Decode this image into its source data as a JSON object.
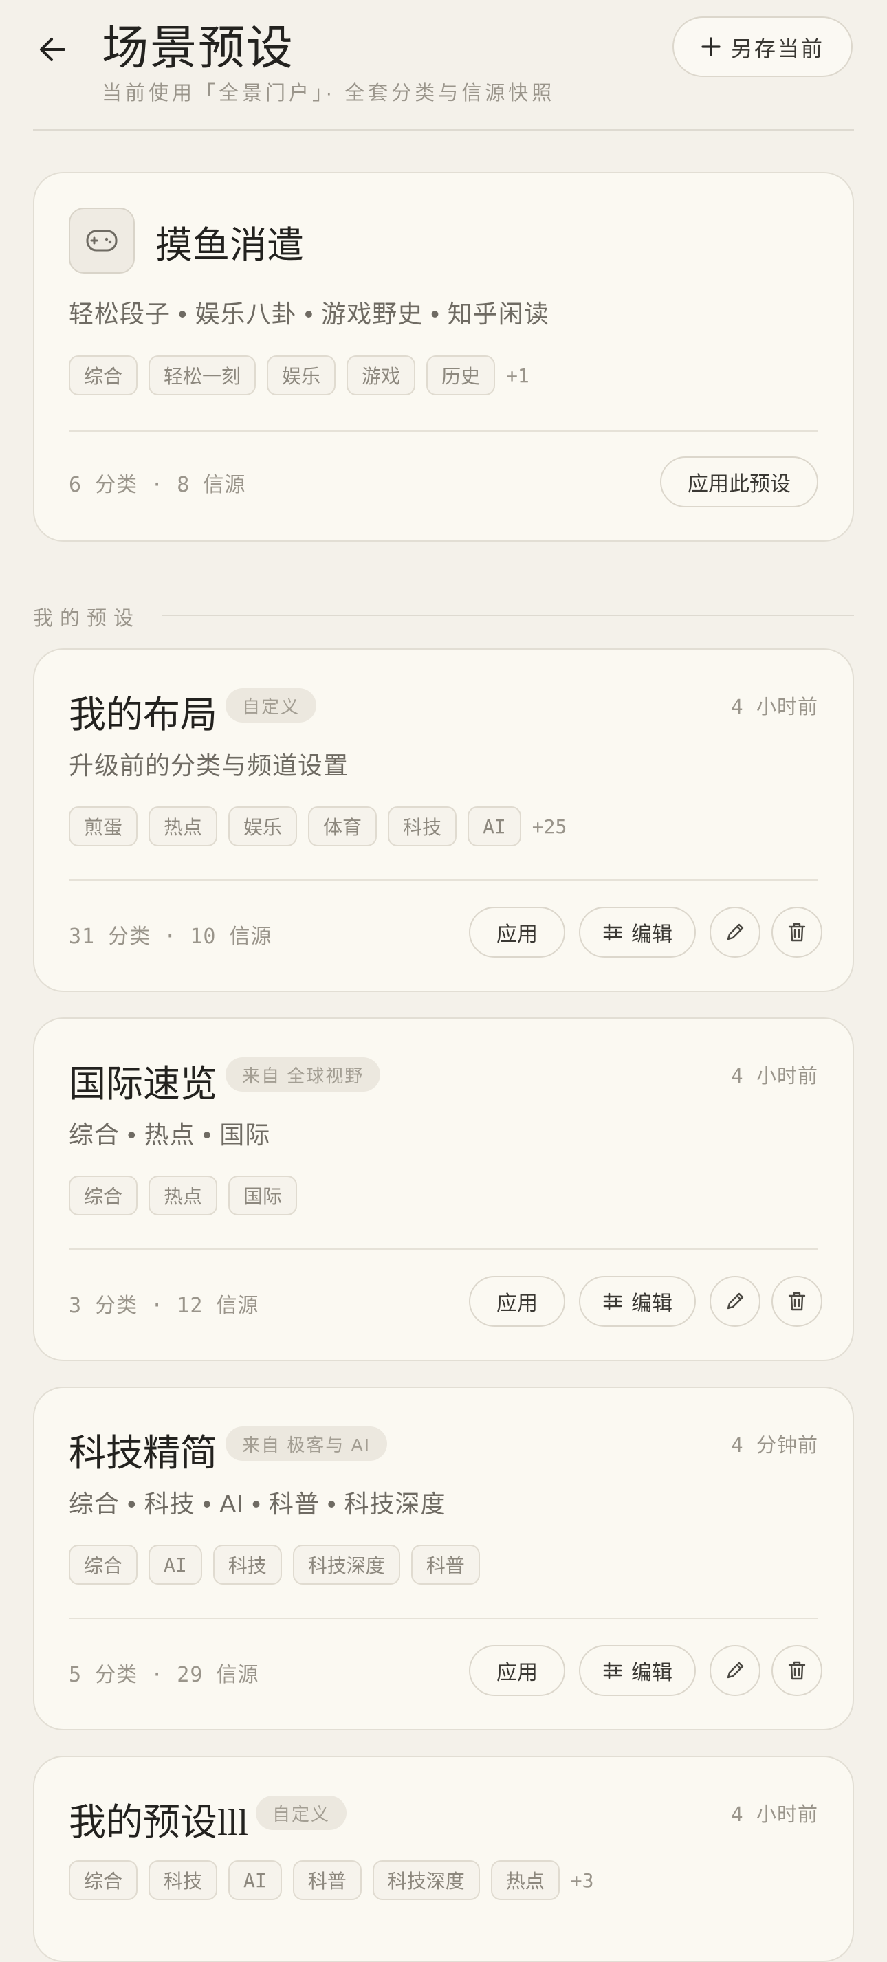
{
  "header": {
    "title": "场景预设",
    "subtitle": "当前使用「全景门户」· 全套分类与信源快照",
    "save_label": "另存当前"
  },
  "featured": {
    "title": "摸鱼消遣",
    "icon": "gamepad-icon",
    "description": "轻松段子 • 娱乐八卦 • 游戏野史 • 知乎闲读",
    "chips": [
      "综合",
      "轻松一刻",
      "娱乐",
      "游戏",
      "历史"
    ],
    "more": "+1",
    "counts": "6 分类 · 8 信源",
    "apply_label": "应用此预设"
  },
  "section_label": "我的预设",
  "presets": [
    {
      "title": "我的布局",
      "badge": "自定义",
      "time": "4 小时前",
      "description": "升级前的分类与频道设置",
      "chips": [
        "煎蛋",
        "热点",
        "娱乐",
        "体育",
        "科技",
        "AI"
      ],
      "more": "+25",
      "counts": "31 分类 · 10 信源",
      "apply_label": "应用",
      "edit_label": "编辑"
    },
    {
      "title": "国际速览",
      "badge": "来自 全球视野",
      "time": "4 小时前",
      "description": "综合 • 热点 • 国际",
      "chips": [
        "综合",
        "热点",
        "国际"
      ],
      "more": "",
      "counts": "3 分类 · 12 信源",
      "apply_label": "应用",
      "edit_label": "编辑"
    },
    {
      "title": "科技精简",
      "badge": "来自 极客与 AI",
      "time": "4 分钟前",
      "description": "综合 • 科技 • AI • 科普 • 科技深度",
      "chips": [
        "综合",
        "AI",
        "科技",
        "科技深度",
        "科普"
      ],
      "more": "",
      "counts": "5 分类 · 29 信源",
      "apply_label": "应用",
      "edit_label": "编辑"
    },
    {
      "title": "我的预设lll",
      "badge": "自定义",
      "time": "4 小时前",
      "chips": [
        "综合",
        "科技",
        "AI",
        "科普",
        "科技深度",
        "热点"
      ],
      "more": "+3"
    }
  ],
  "colors": {
    "background": "#f4f1ea",
    "card": "#fbf9f2",
    "border": "#e2ded4",
    "text": "#23221f",
    "muted": "#9a958b"
  }
}
